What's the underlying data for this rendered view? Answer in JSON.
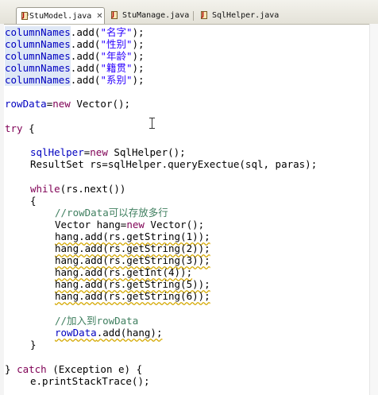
{
  "tabs": [
    {
      "label": "*StuModel.java",
      "close": "✕",
      "active": true
    },
    {
      "label": "StuManage.java",
      "active": false
    },
    {
      "label": "SqlHelper.java",
      "active": false
    }
  ],
  "code": {
    "l1": {
      "a": "columnNames",
      "b": ".add(",
      "s": "\"名字\"",
      "c": ");"
    },
    "l2": {
      "a": "columnNames",
      "b": ".add(",
      "s": "\"性别\"",
      "c": ");"
    },
    "l3": {
      "a": "columnNames",
      "b": ".add(",
      "s": "\"年龄\"",
      "c": ");"
    },
    "l4": {
      "a": "columnNames",
      "b": ".add(",
      "s": "\"籍贯\"",
      "c": ");"
    },
    "l5": {
      "a": "columnNames",
      "b": ".add(",
      "s": "\"系别\"",
      "c": ");"
    },
    "l6": {
      "a": "rowData",
      "b": "=",
      "k": "new",
      "c": " Vector();"
    },
    "l7": {
      "k": "try",
      "c": " {"
    },
    "l8": {
      "a": "sqlHelper",
      "b": "=",
      "k": "new",
      "c": " SqlHelper();"
    },
    "l9": {
      "c": "ResultSet rs=sqlHelper.queryExectue(sql, paras);"
    },
    "l10": {
      "k": "while",
      "c": "(rs.next())"
    },
    "l11": {
      "c": "{"
    },
    "l12": {
      "cm": "//rowData可以存放多行"
    },
    "l13": {
      "a": "Vector hang=",
      "k": "new",
      "c": " Vector();"
    },
    "l14": {
      "c": "hang.add(rs.getString(1));"
    },
    "l15": {
      "c": "hang.add(rs.getString(2));"
    },
    "l16": {
      "c": "hang.add(rs.getString(3));"
    },
    "l17": {
      "c": "hang.add(rs.getInt(4));"
    },
    "l18": {
      "c": "hang.add(rs.getString(5));"
    },
    "l19": {
      "c": "hang.add(rs.getString(6));"
    },
    "l20": {
      "cm": "//加入到rowData"
    },
    "l21": {
      "a": "rowData",
      "c": ".add(hang);"
    },
    "l22": {
      "c": "}"
    },
    "l23": {
      "a": "} ",
      "k": "catch",
      "c": " (Exception e) {"
    },
    "l24": {
      "c": "e.printStackTrace();"
    }
  }
}
